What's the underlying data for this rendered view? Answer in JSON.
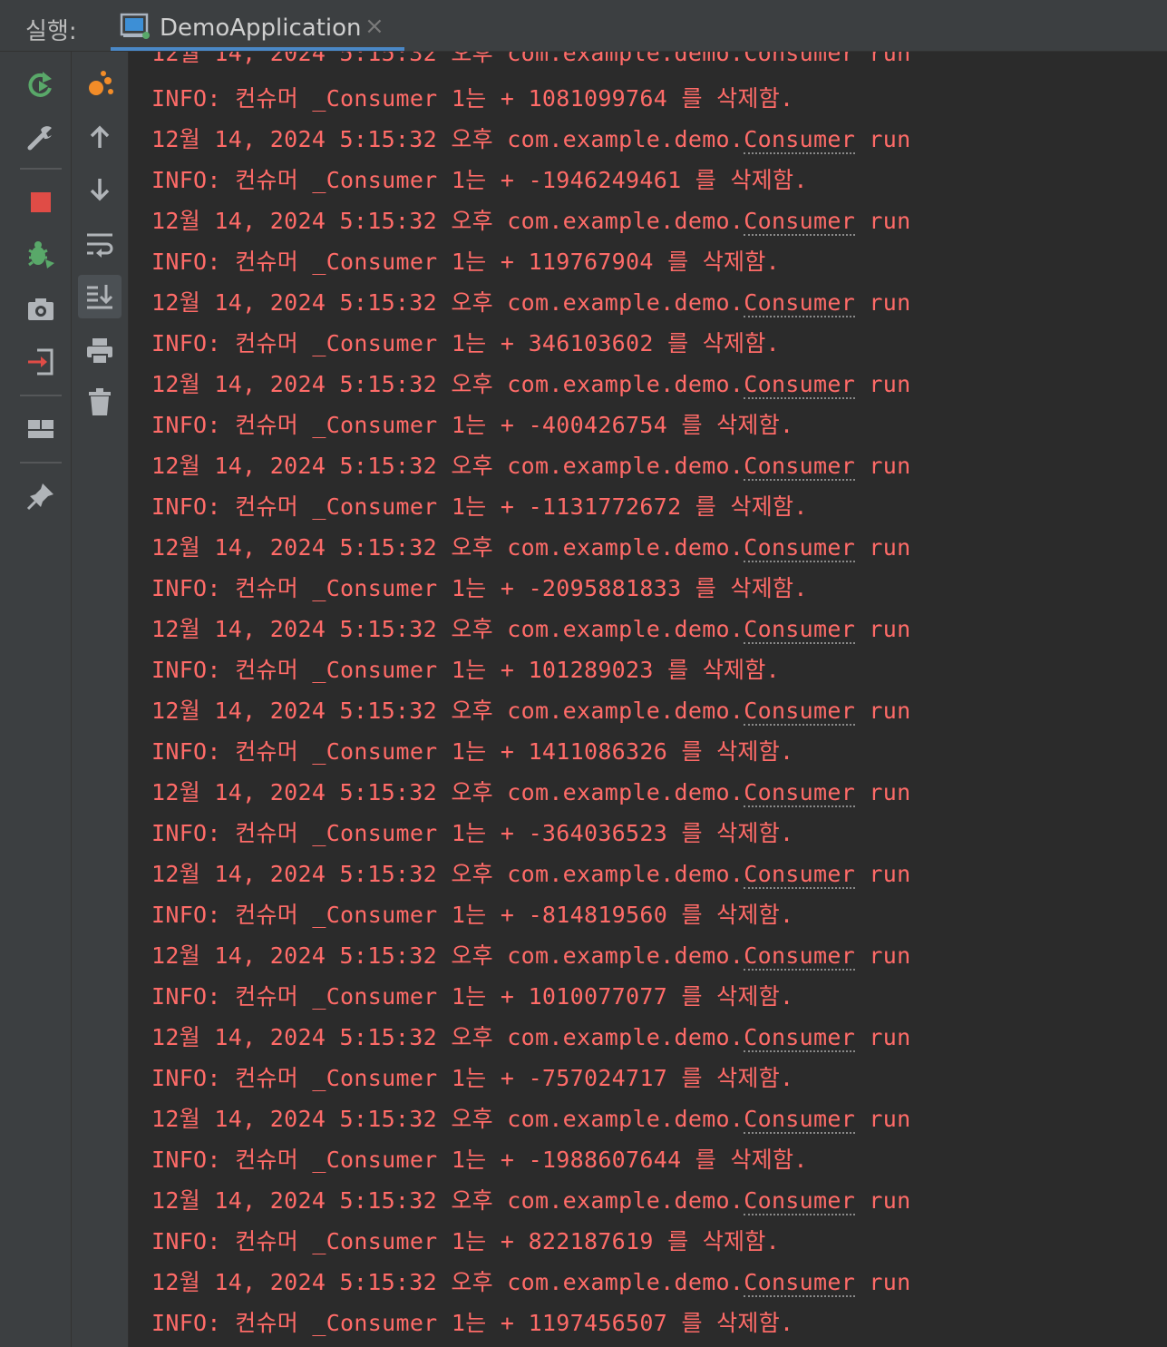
{
  "run_panel": {
    "label": "실행:",
    "tab_title": "DemoApplication",
    "tab_close": "×"
  },
  "toolbar_left": [
    {
      "name": "rerun-icon"
    },
    {
      "name": "wrench-icon"
    },
    {
      "name": "stop-icon"
    },
    {
      "name": "debug-icon"
    },
    {
      "name": "camera-icon"
    },
    {
      "name": "login-icon"
    },
    {
      "name": "layout-icon"
    },
    {
      "name": "pin-icon"
    }
  ],
  "toolbar_right": [
    {
      "name": "profiler-icon"
    },
    {
      "name": "arrow-up-icon"
    },
    {
      "name": "arrow-down-icon"
    },
    {
      "name": "soft-wrap-icon"
    },
    {
      "name": "scroll-to-end-icon"
    },
    {
      "name": "print-icon"
    },
    {
      "name": "trash-icon"
    }
  ],
  "colors": {
    "accent": "#4a88c7",
    "log_text": "#ff6b68",
    "background": "#2b2b2b"
  },
  "console": {
    "partial_top": "12월 14, 2024 5:15:32 오후 com.example.demo.Consumer run",
    "timestamp_line": {
      "prefix": "12월 14, 2024 5:15:32 오후 com.example.demo.",
      "class": "Consumer",
      "suffix": " run"
    },
    "info_prefix": "INFO: 컨슈머 _Consumer 1는 + ",
    "info_suffix": " 를 삭제함.",
    "values": [
      "1081099764",
      "-1946249461",
      "119767904",
      "346103602",
      "-400426754",
      "-1131772672",
      "-2095881833",
      "101289023",
      "1411086326",
      "-364036523",
      "-814819560",
      "1010077077",
      "-757024717",
      "-1988607644",
      "822187619",
      "1197456507"
    ]
  }
}
